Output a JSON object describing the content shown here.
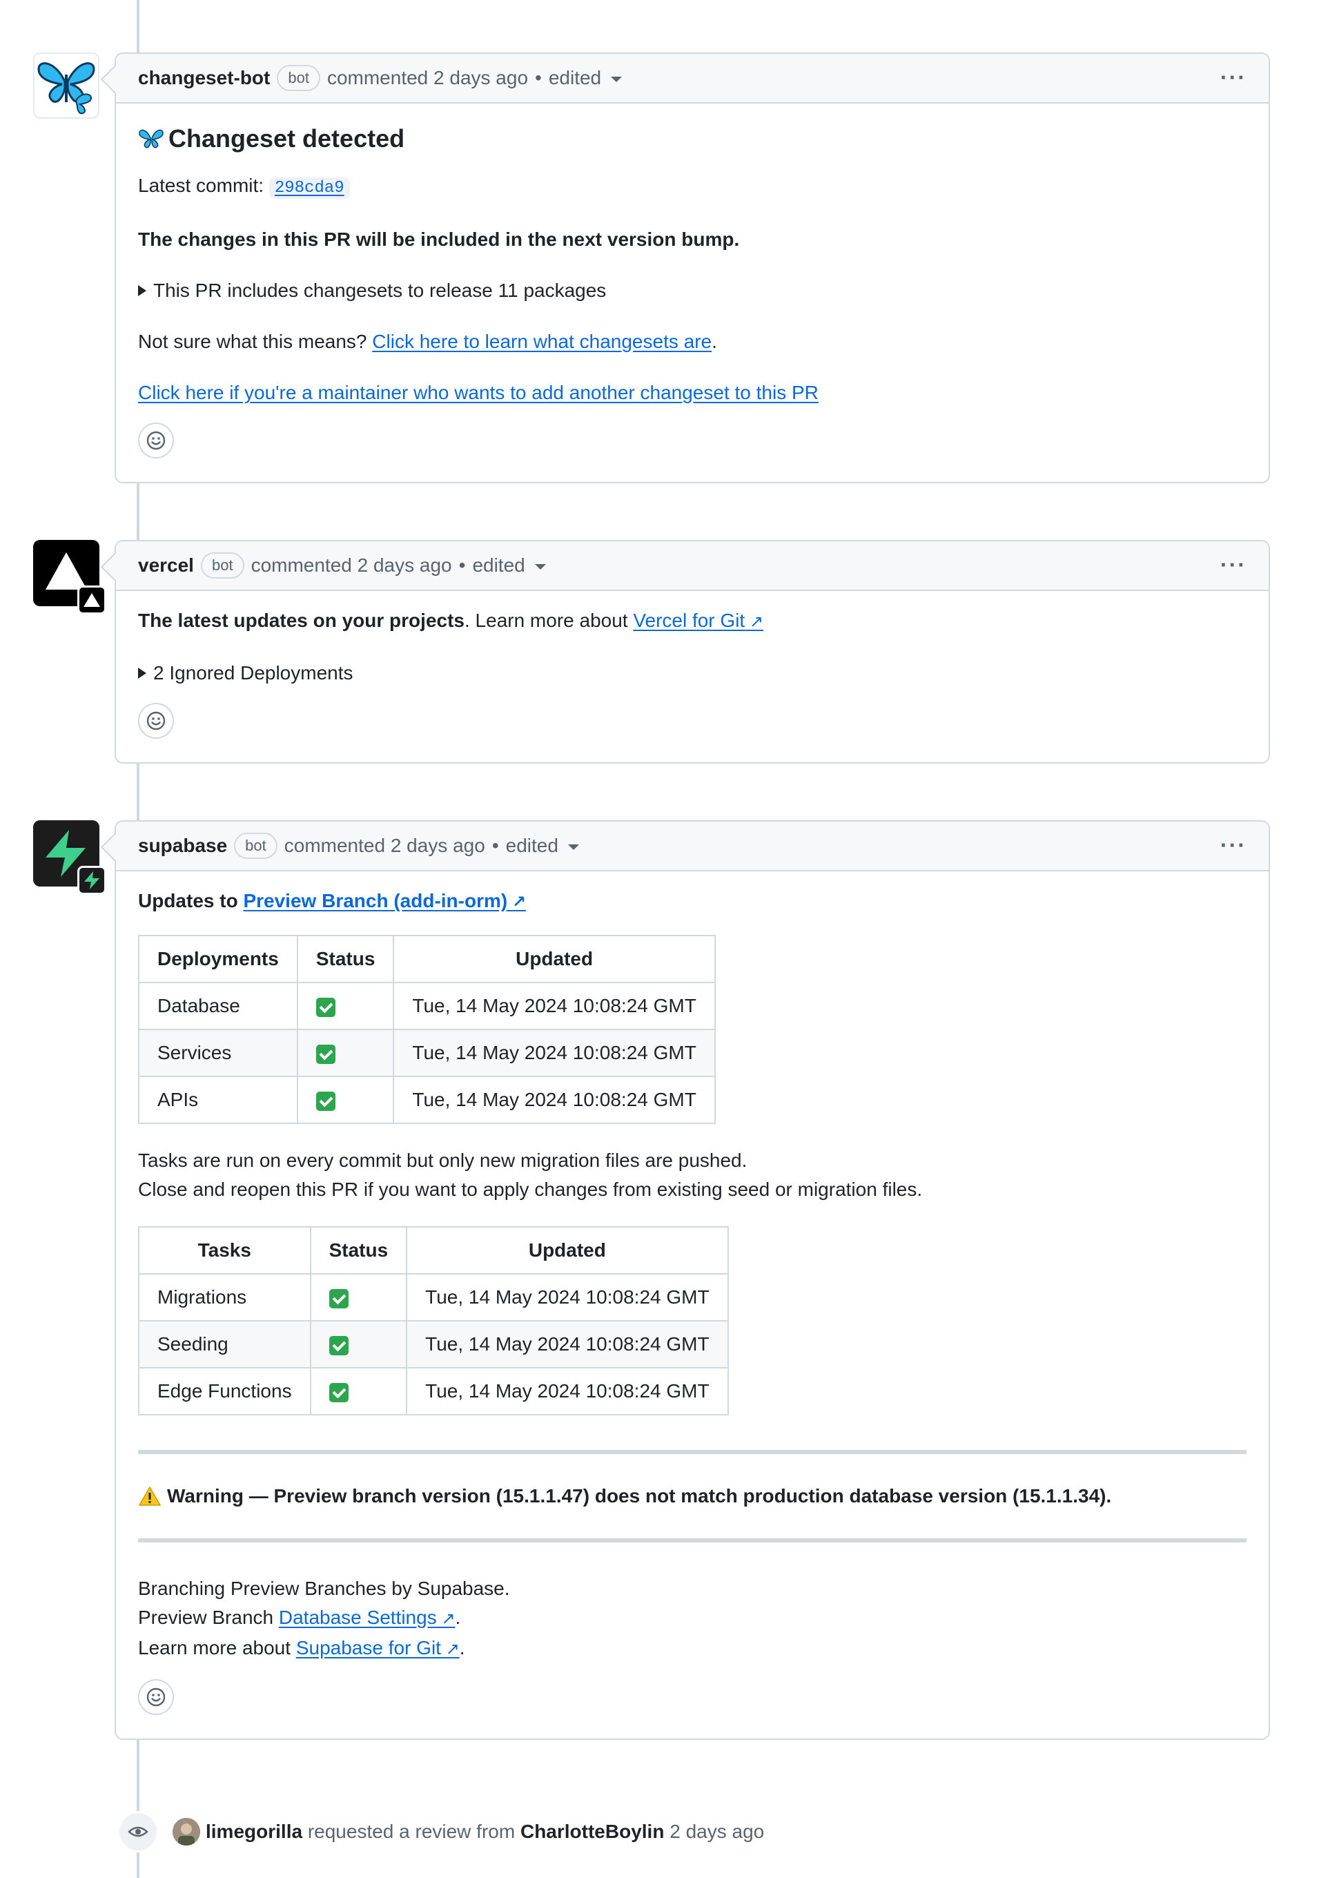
{
  "comments": [
    {
      "author": "changeset-bot",
      "badge": "bot",
      "meta": "commented 2 days ago",
      "edited": "edited",
      "title": "Changeset detected",
      "latest_commit_label": "Latest commit:",
      "commit_sha": "298cda9",
      "bold_line": "The changes in this PR will be included in the next version bump.",
      "details_summary": "This PR includes changesets to release 11 packages",
      "not_sure_text": "Not sure what this means?",
      "learn_link": "Click here to learn what changesets are",
      "maintainer_link": "Click here if you're a maintainer who wants to add another changeset to this PR"
    },
    {
      "author": "vercel",
      "badge": "bot",
      "meta": "commented 2 days ago",
      "edited": "edited",
      "bold_line": "The latest updates on your projects",
      "learn_more_text": ". Learn more about",
      "link": "Vercel for Git",
      "details_summary": "2 Ignored Deployments"
    },
    {
      "author": "supabase",
      "badge": "bot",
      "meta": "commented 2 days ago",
      "edited": "edited",
      "updates_to": "Updates to",
      "preview_link": "Preview Branch (add-in-orm)",
      "deploy_table": {
        "headers": [
          "Deployments",
          "Status",
          "Updated"
        ],
        "rows": [
          {
            "name": "Database",
            "updated": "Tue, 14 May 2024 10:08:24 GMT"
          },
          {
            "name": "Services",
            "updated": "Tue, 14 May 2024 10:08:24 GMT"
          },
          {
            "name": "APIs",
            "updated": "Tue, 14 May 2024 10:08:24 GMT"
          }
        ]
      },
      "tasks_line1": "Tasks are run on every commit but only new migration files are pushed.",
      "tasks_line2": "Close and reopen this PR if you want to apply changes from existing seed or migration files.",
      "tasks_table": {
        "headers": [
          "Tasks",
          "Status",
          "Updated"
        ],
        "rows": [
          {
            "name": "Migrations",
            "updated": "Tue, 14 May 2024 10:08:24 GMT"
          },
          {
            "name": "Seeding",
            "updated": "Tue, 14 May 2024 10:08:24 GMT"
          },
          {
            "name": "Edge Functions",
            "updated": "Tue, 14 May 2024 10:08:24 GMT"
          }
        ]
      },
      "warning": "Warning — Preview branch version (15.1.1.47) does not match production database version (15.1.1.34).",
      "footer_line1": "Branching Preview Branches by Supabase.",
      "footer_line2_prefix": "Preview Branch",
      "footer_line2_link": "Database Settings",
      "footer_line3_prefix": "Learn more about",
      "footer_line3_link": "Supabase for Git",
      "period": "."
    }
  ],
  "event": {
    "user": "limegorilla",
    "action": "requested a review from",
    "target": "CharlotteBoylin",
    "time": "2 days ago"
  },
  "colors": {
    "link": "#0969da",
    "border": "#d1d9e0",
    "muted": "#59636e",
    "supabase_green": "#3ecf8e",
    "check_green": "#2da44e",
    "butterfly_blue": "#2fb8f0"
  },
  "icons": {
    "comment_menu": "kebab-horizontal-icon",
    "reaction": "smiley-icon",
    "event": "eye-icon"
  }
}
